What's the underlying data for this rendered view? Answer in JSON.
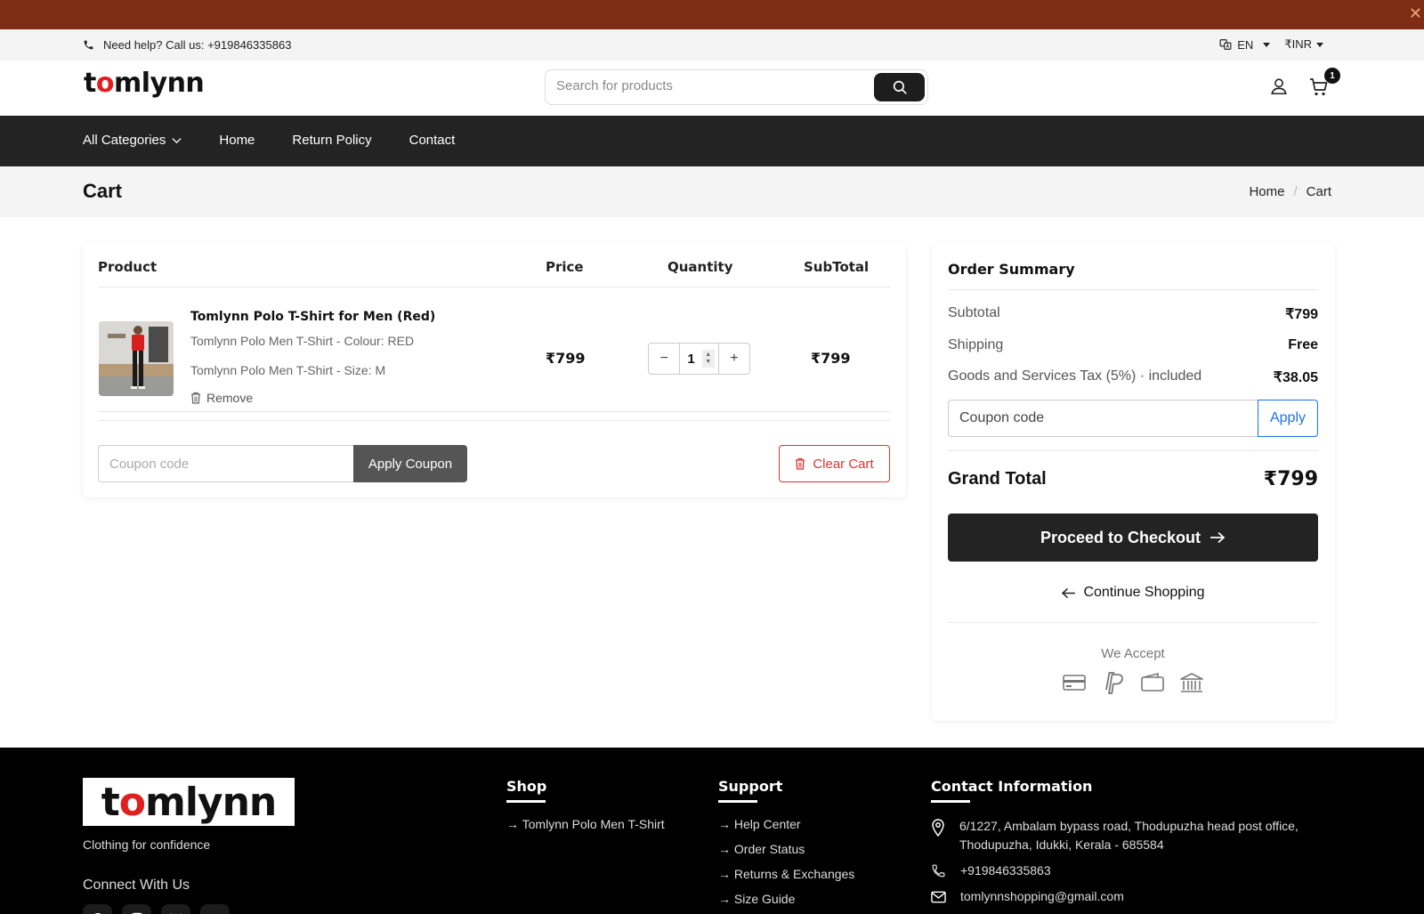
{
  "topbar": {
    "help_text": "Need help? Call us: +919846335863",
    "language": "EN",
    "currency": "₹INR"
  },
  "header": {
    "logo_prefix": "t",
    "logo_o": "o",
    "logo_suffix": "mlynn",
    "search_placeholder": "Search for products",
    "cart_count": "1"
  },
  "nav": {
    "items": [
      "All Categories",
      "Home",
      "Return Policy",
      "Contact"
    ]
  },
  "page": {
    "title": "Cart",
    "breadcrumb": [
      "Home",
      "Cart"
    ]
  },
  "cart": {
    "headers": {
      "product": "Product",
      "price": "Price",
      "quantity": "Quantity",
      "subtotal": "SubTotal"
    },
    "items": [
      {
        "name": "Tomlynn Polo T-Shirt for Men (Red)",
        "variant_colour": "Tomlynn Polo Men T-Shirt - Colour: RED",
        "variant_size": "Tomlynn Polo Men T-Shirt - Size: M",
        "remove_label": "Remove",
        "price": "₹799",
        "quantity": "1",
        "subtotal": "₹799"
      }
    ],
    "coupon_placeholder": "Coupon code",
    "apply_coupon_label": "Apply Coupon",
    "clear_cart_label": "Clear Cart"
  },
  "summary": {
    "title": "Order Summary",
    "rows": [
      {
        "label": "Subtotal",
        "value": "₹799"
      },
      {
        "label": "Shipping",
        "value": "Free"
      },
      {
        "label": "Goods and Services Tax (5%) · included",
        "value": "₹38.05"
      }
    ],
    "coupon_placeholder": "Coupon code",
    "apply_label": "Apply",
    "grand_total_label": "Grand Total",
    "grand_total_value": "₹799",
    "checkout_label": "Proceed to Checkout",
    "continue_label": "Continue Shopping",
    "we_accept": "We Accept",
    "payment_icons": [
      "credit-card-icon",
      "paypal-icon",
      "wallet-icon",
      "bank-icon"
    ]
  },
  "footer": {
    "logo_prefix": "t",
    "logo_o": "o",
    "logo_suffix": "mlynn",
    "tagline": "Clothing for confidence",
    "connect": "Connect With Us",
    "shop": {
      "title": "Shop",
      "links": [
        "Tomlynn Polo Men T-Shirt"
      ]
    },
    "support": {
      "title": "Support",
      "links": [
        "Help Center",
        "Order Status",
        "Returns & Exchanges",
        "Size Guide"
      ]
    },
    "contact": {
      "title": "Contact Information",
      "address": "6/1227, Ambalam bypass road, Thodupuzha head post office, Thodupuzha, Idukki, Kerala - 685584",
      "phone": "+919846335863",
      "email": "tomlynnshopping@gmail.com"
    }
  },
  "colors": {
    "announce_bar": "#7e2d14",
    "nav_bg": "#232323",
    "accent_red": "#e02020",
    "apply_blue": "#1a73e8",
    "danger": "#dd3333"
  }
}
